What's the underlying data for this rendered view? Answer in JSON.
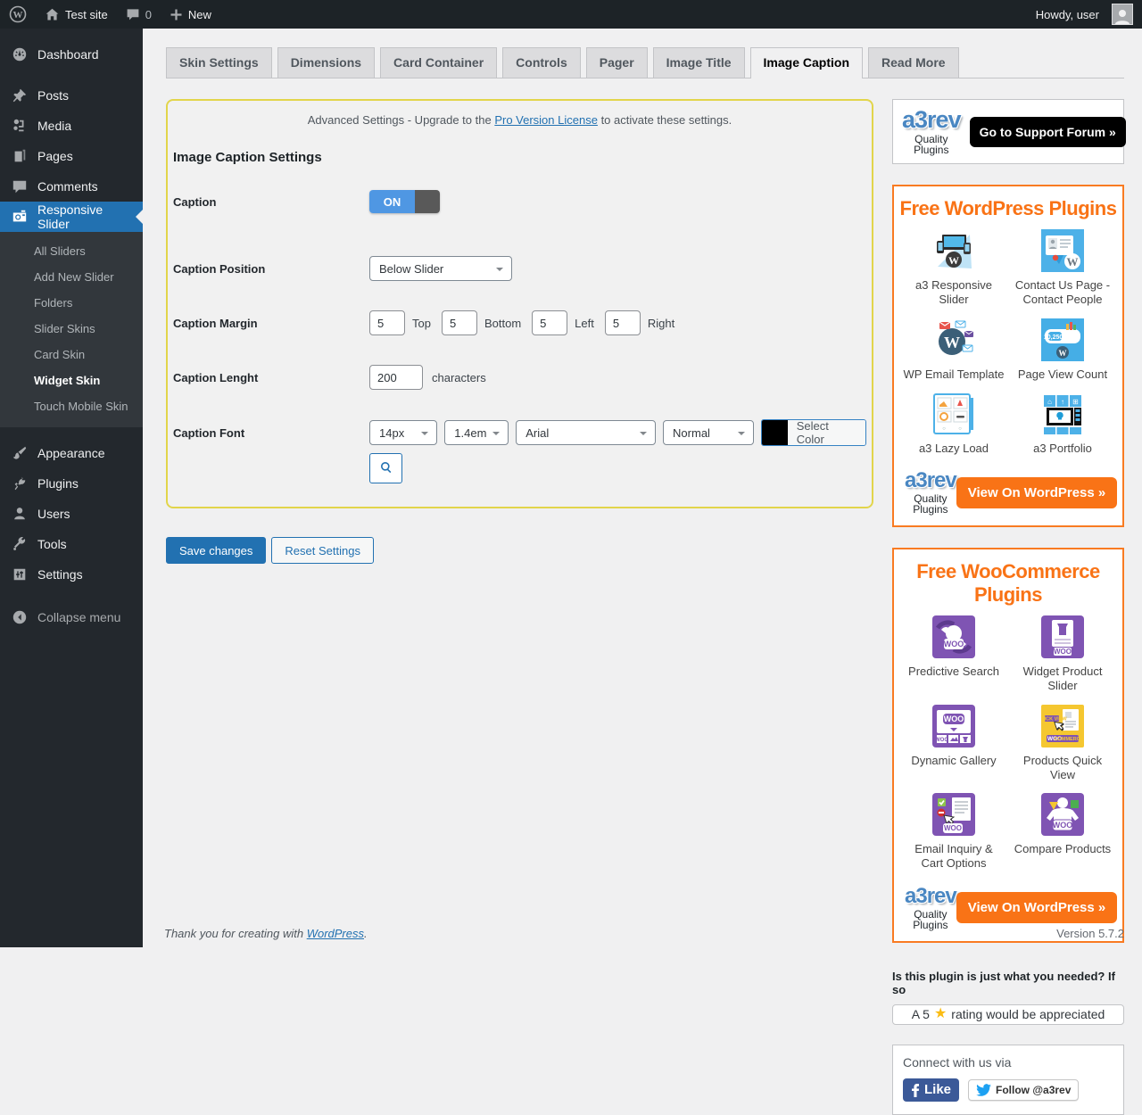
{
  "admin_bar": {
    "site_name": "Test site",
    "comments_count": "0",
    "new_label": "New",
    "howdy": "Howdy, user"
  },
  "sidebar": {
    "items": [
      {
        "label": "Dashboard"
      },
      {
        "label": "Posts"
      },
      {
        "label": "Media"
      },
      {
        "label": "Pages"
      },
      {
        "label": "Comments"
      },
      {
        "label": "Responsive Slider"
      },
      {
        "label": "Appearance"
      },
      {
        "label": "Plugins"
      },
      {
        "label": "Users"
      },
      {
        "label": "Tools"
      },
      {
        "label": "Settings"
      },
      {
        "label": "Collapse menu"
      }
    ],
    "submenu": [
      {
        "label": "All Sliders"
      },
      {
        "label": "Add New Slider"
      },
      {
        "label": "Folders"
      },
      {
        "label": "Slider Skins"
      },
      {
        "label": "Card Skin"
      },
      {
        "label": "Widget Skin"
      },
      {
        "label": "Touch Mobile Skin"
      }
    ]
  },
  "tabs": [
    "Skin Settings",
    "Dimensions",
    "Card Container",
    "Controls",
    "Pager",
    "Image Title",
    "Image Caption",
    "Read More"
  ],
  "panel": {
    "notice_prefix": "Advanced Settings - Upgrade to the",
    "notice_link": "Pro Version License",
    "notice_suffix": "to activate these settings.",
    "heading": "Image Caption Settings",
    "caption_label": "Caption",
    "caption_toggle_on": "ON",
    "position_label": "Caption Position",
    "position_value": "Below Slider",
    "margin_label": "Caption Margin",
    "margin_values": [
      "5",
      "5",
      "5",
      "5"
    ],
    "margin_names": [
      "Top",
      "Bottom",
      "Left",
      "Right"
    ],
    "length_label": "Caption Lenght",
    "length_value": "200",
    "length_suffix": "characters",
    "font_label": "Caption Font",
    "font_size": "14px",
    "line_height": "1.4em",
    "font_family": "Arial",
    "font_style": "Normal",
    "select_color": "Select Color"
  },
  "actions": {
    "save": "Save changes",
    "reset": "Reset Settings"
  },
  "promo": {
    "logo_name": "a3rev",
    "logo_tag": "Quality Plugins",
    "support_button": "Go to Support Forum »",
    "wp_title": "Free WordPress Plugins",
    "wp_plugins": [
      {
        "name": "a3 Responsive Slider"
      },
      {
        "name": "Contact Us Page - Contact People"
      },
      {
        "name": "WP Email Template"
      },
      {
        "name": "Page View Count"
      },
      {
        "name": "a3 Lazy Load"
      },
      {
        "name": "a3 Portfolio"
      }
    ],
    "woo_title": "Free WooCommerce Plugins",
    "woo_plugins": [
      {
        "name": "Predictive Search"
      },
      {
        "name": "Widget Product Slider"
      },
      {
        "name": "Dynamic Gallery"
      },
      {
        "name": "Products Quick View"
      },
      {
        "name": "Email Inquiry & Cart Options"
      },
      {
        "name": "Compare Products"
      }
    ],
    "view_button": "View On WordPress »",
    "rating_head": "Is this plugin is just what you needed? If so",
    "rating_prefix": "A 5",
    "rating_star": "★",
    "rating_suffix": "rating would be appreciated",
    "connect_title": "Connect with us via",
    "fb_like": "Like",
    "tw_follow": "Follow @a3rev"
  },
  "footer": {
    "thanks_prefix": "Thank you for creating with",
    "thanks_link": "WordPress",
    "thanks_period": ".",
    "version": "Version 5.7.2"
  }
}
